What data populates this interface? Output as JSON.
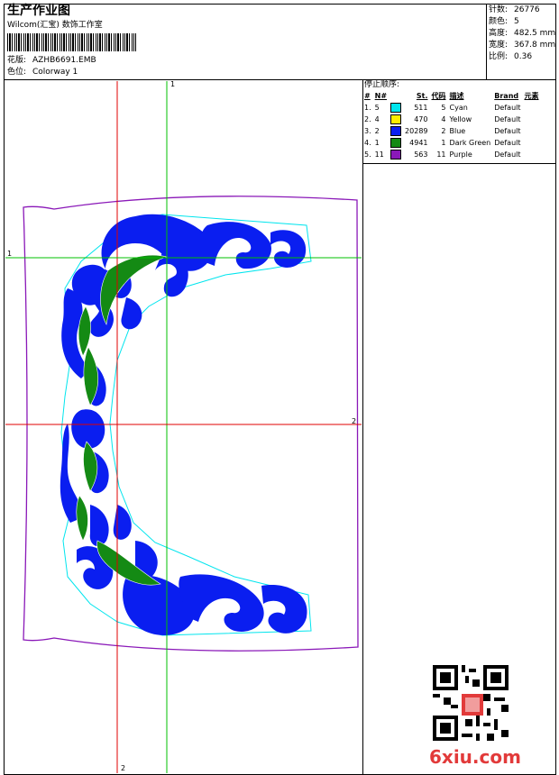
{
  "header": {
    "title": "生产作业图",
    "subtitle": "Wilcom(汇宝) 数饰工作室",
    "design_label": "花版:",
    "design_value": "AZHB6691.EMB",
    "colorway_label": "色位:",
    "colorway_value": "Colorway 1"
  },
  "stats": [
    {
      "label": "针数:",
      "value": "26776"
    },
    {
      "label": "颜色:",
      "value": "5"
    },
    {
      "label": "高度:",
      "value": "482.5 mm"
    },
    {
      "label": "宽度:",
      "value": "367.8 mm"
    },
    {
      "label": "比例:",
      "value": "0.36"
    }
  ],
  "stop_sequence": {
    "title": "停止顺序:",
    "headers": [
      "#",
      "N#",
      "St.",
      "代码",
      "描述",
      "Brand",
      "元素"
    ],
    "rows": [
      {
        "idx": "1.",
        "n": "5",
        "color": "#00e5ee",
        "st": "511",
        "code": "5",
        "desc": "Cyan",
        "brand": "Default"
      },
      {
        "idx": "2.",
        "n": "4",
        "color": "#ffee00",
        "st": "470",
        "code": "4",
        "desc": "Yellow",
        "brand": "Default"
      },
      {
        "idx": "3.",
        "n": "2",
        "color": "#0a1ef0",
        "st": "20289",
        "code": "2",
        "desc": "Blue",
        "brand": "Default"
      },
      {
        "idx": "4.",
        "n": "1",
        "color": "#148a14",
        "st": "4941",
        "code": "1",
        "desc": "Dark Green",
        "brand": "Default"
      },
      {
        "idx": "5.",
        "n": "11",
        "color": "#8a18b8",
        "st": "563",
        "code": "11",
        "desc": "Purple",
        "brand": "Default"
      }
    ]
  },
  "guides": {
    "v1": "1",
    "h1": "1",
    "h2": "2",
    "v2": "2"
  },
  "colors": {
    "blue": "#0a1ef0",
    "green": "#148a14",
    "cyan": "#00e5ee",
    "purple": "#8a18b8",
    "red": "#e00000",
    "guide_green": "#00c000"
  },
  "watermark": "6xiu.com"
}
